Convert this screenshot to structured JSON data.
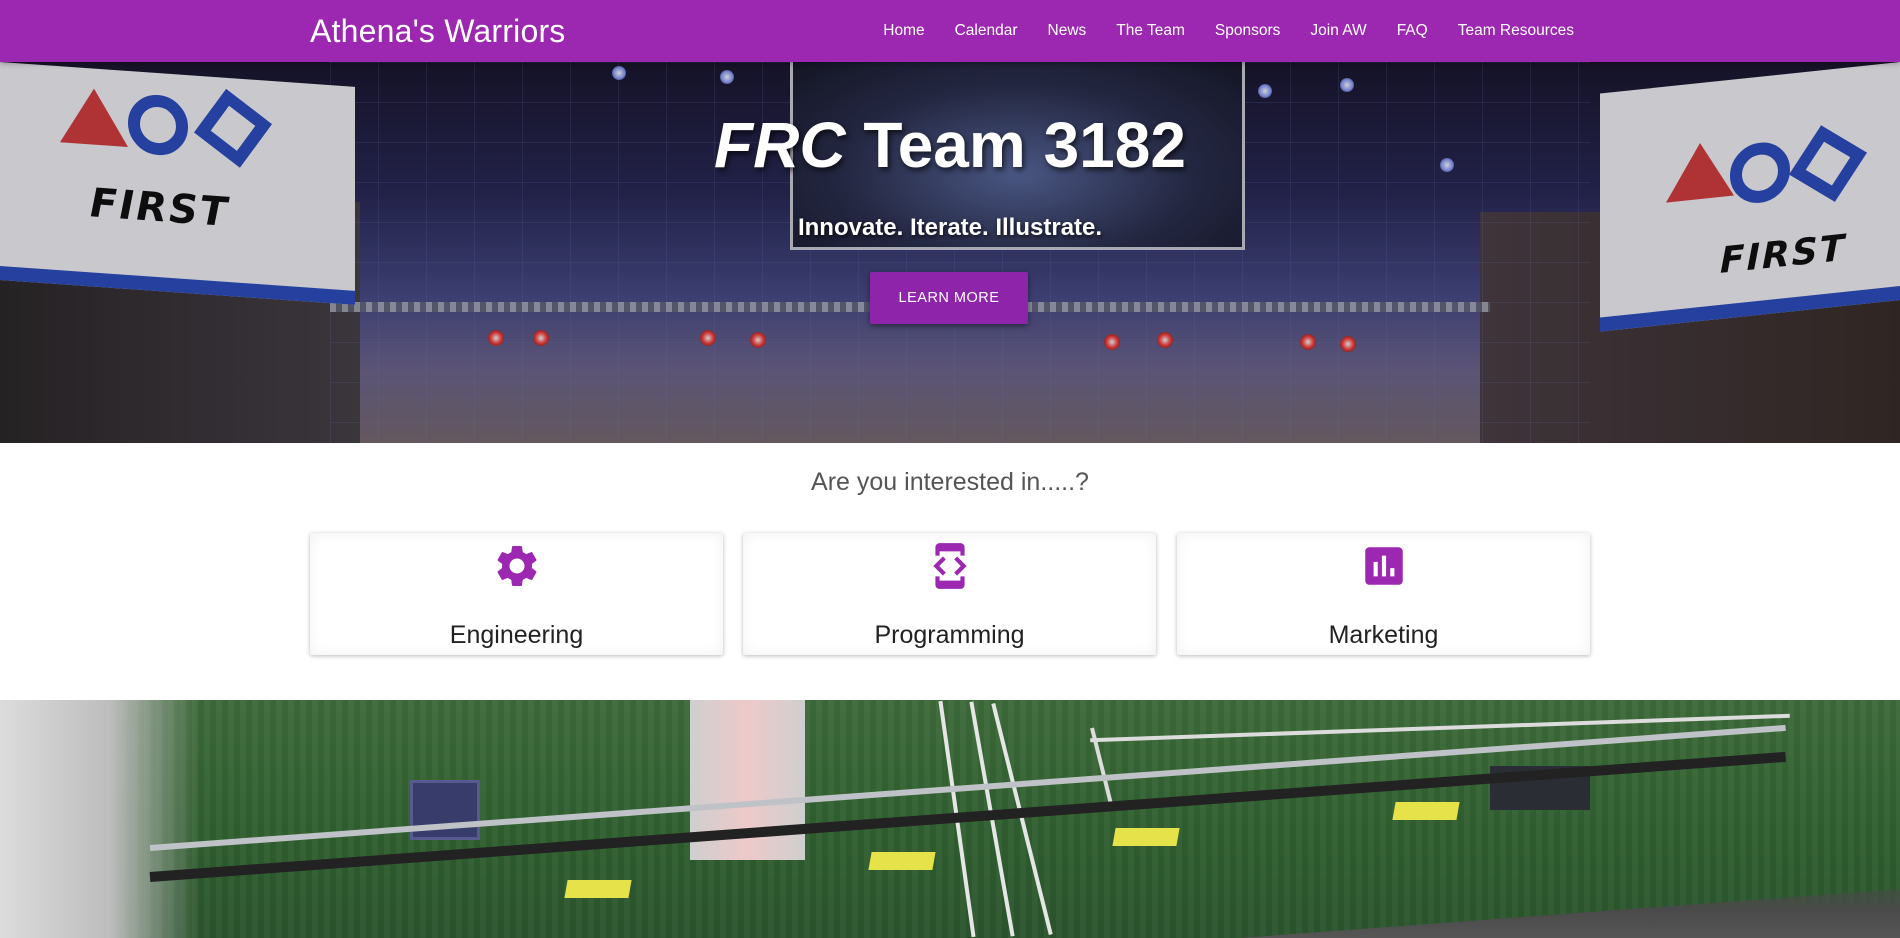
{
  "navbar": {
    "brand": "Athena's Warriors",
    "items": [
      "Home",
      "Calendar",
      "News",
      "The Team",
      "Sponsors",
      "Join AW",
      "FAQ",
      "Team Resources"
    ]
  },
  "hero": {
    "title_italic": "FRC",
    "title_rest": " Team 3182",
    "tagline": "Innovate. Iterate. Illustrate.",
    "button_label": "LEARN MORE",
    "banner_text": "FIRST"
  },
  "interest": {
    "title": "Are you interested in.....?",
    "cards": [
      {
        "label": "Engineering",
        "icon": "gear-icon"
      },
      {
        "label": "Programming",
        "icon": "developer-mode-icon"
      },
      {
        "label": "Marketing",
        "icon": "bar-chart-icon"
      }
    ]
  },
  "colors": {
    "primary": "#9c27b0",
    "button": "#8e24aa",
    "icon": "#9c27b0"
  }
}
